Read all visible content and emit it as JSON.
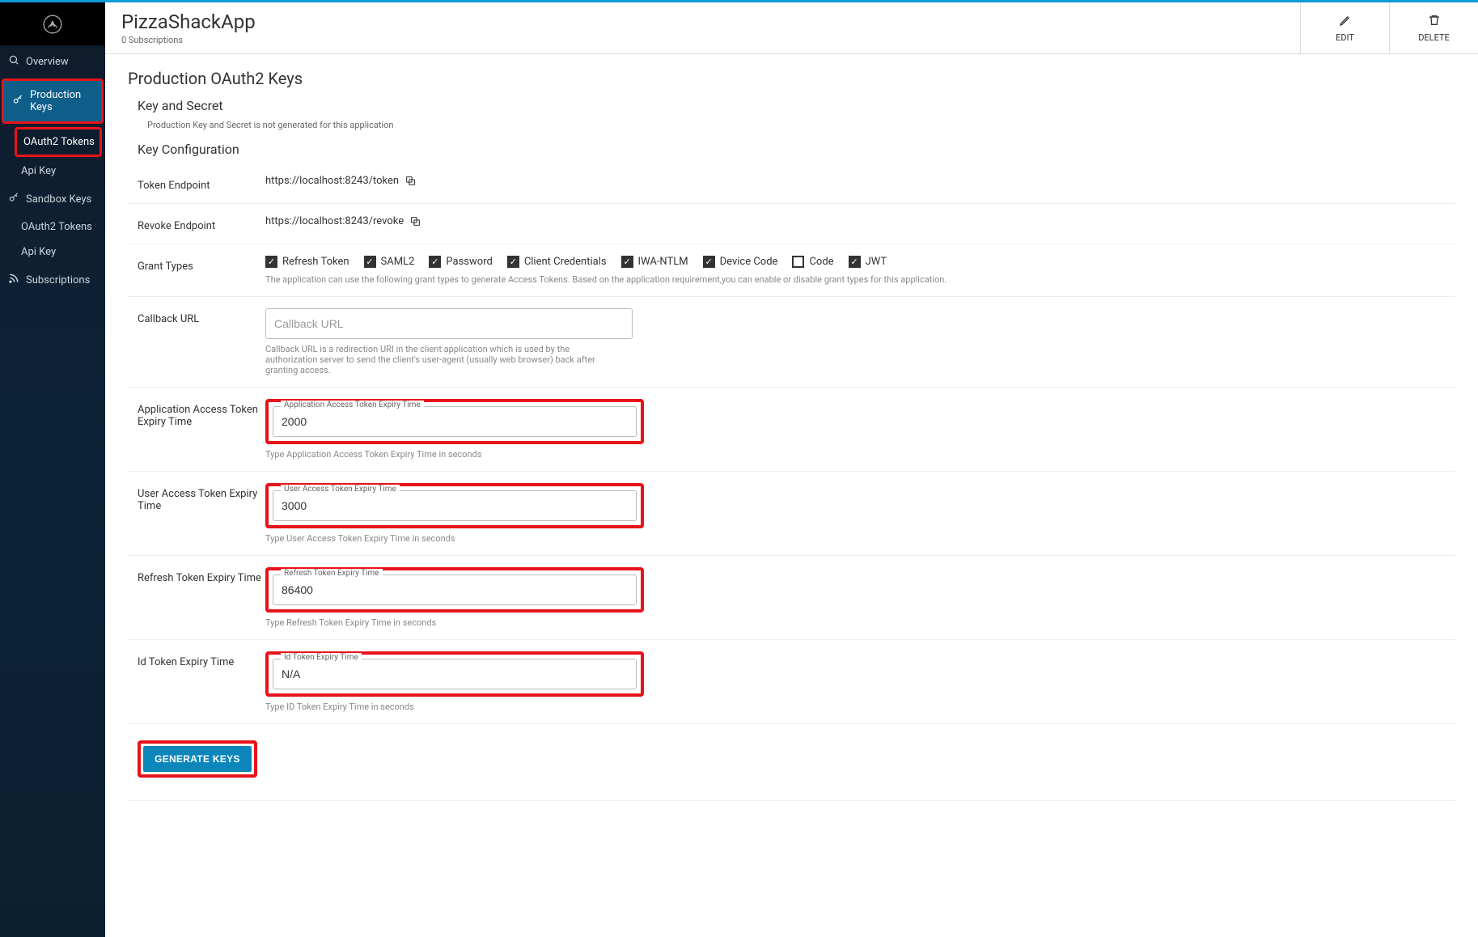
{
  "sidebar": {
    "items": [
      {
        "label": "Overview",
        "icon": "search"
      },
      {
        "label": "Production Keys",
        "icon": "key"
      },
      {
        "label": "Sandbox Keys",
        "icon": "key"
      },
      {
        "label": "Subscriptions",
        "icon": "rss"
      }
    ],
    "prodSub": [
      {
        "label": "OAuth2 Tokens"
      },
      {
        "label": "Api Key"
      }
    ],
    "sandboxSub": [
      {
        "label": "OAuth2 Tokens"
      },
      {
        "label": "Api Key"
      }
    ]
  },
  "header": {
    "title": "PizzaShackApp",
    "subscriptions": "0 Subscriptions",
    "edit": "EDIT",
    "delete": "DELETE"
  },
  "page": {
    "title": "Production OAuth2 Keys",
    "keySecretTitle": "Key and Secret",
    "keySecretNote": "Production Key and Secret is not generated for this application",
    "keyConfigTitle": "Key Configuration"
  },
  "endpoints": {
    "tokenLabel": "Token Endpoint",
    "tokenValue": "https://localhost:8243/token",
    "revokeLabel": "Revoke Endpoint",
    "revokeValue": "https://localhost:8243/revoke"
  },
  "grantTypes": {
    "label": "Grant Types",
    "note": "The application can use the following grant types to generate Access Tokens. Based on the application requirement,you can enable or disable grant types for this application.",
    "items": [
      {
        "label": "Refresh Token",
        "checked": true
      },
      {
        "label": "SAML2",
        "checked": true
      },
      {
        "label": "Password",
        "checked": true
      },
      {
        "label": "Client Credentials",
        "checked": true
      },
      {
        "label": "IWA-NTLM",
        "checked": true
      },
      {
        "label": "Device Code",
        "checked": true
      },
      {
        "label": "Code",
        "checked": false
      },
      {
        "label": "JWT",
        "checked": true
      }
    ]
  },
  "callback": {
    "label": "Callback URL",
    "placeholder": "Callback URL",
    "help": "Callback URL is a redirection URI in the client application which is used by the authorization server to send the client's user-agent (usually web browser) back after granting access."
  },
  "fields": {
    "appToken": {
      "rowLabel": "Application Access Token Expiry Time",
      "floatLabel": "Application Access Token Expiry Time",
      "value": "2000",
      "help": "Type Application Access Token Expiry Time in seconds"
    },
    "userToken": {
      "rowLabel": "User Access Token Expiry Time",
      "floatLabel": "User Access Token Expiry Time",
      "value": "3000",
      "help": "Type User Access Token Expiry Time in seconds"
    },
    "refreshToken": {
      "rowLabel": "Refresh Token Expiry Time",
      "floatLabel": "Refresh Token Expiry Time",
      "value": "86400",
      "help": "Type Refresh Token Expiry Time in seconds"
    },
    "idToken": {
      "rowLabel": "Id Token Expiry Time",
      "floatLabel": "Id Token Expiry Time",
      "value": "N/A",
      "help": "Type ID Token Expiry Time in seconds"
    }
  },
  "buttons": {
    "generate": "GENERATE KEYS"
  }
}
